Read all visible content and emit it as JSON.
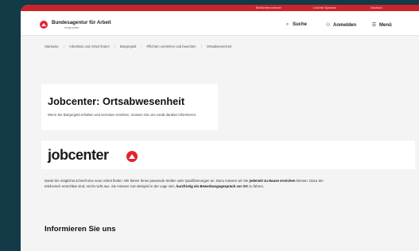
{
  "topbar": {
    "links": [
      "Behördennummer",
      "Leichte Sprache",
      "Deutsch"
    ]
  },
  "header": {
    "brand": "Bundesagentur für Arbeit",
    "brand_sub": "bringt weiter",
    "search_label": "Suche",
    "login_label": "Anmelden",
    "menu_label": "Menü",
    "search_icon": "⌕",
    "user_icon": "⚇",
    "menu_icon": "☰"
  },
  "breadcrumb": [
    "Startseite",
    "Arbeitslos und Arbeit finden",
    "Bürgergeld",
    "Pflichten verstehen und beachten",
    "Ortsabwesenheit"
  ],
  "main": {
    "title": "Jobcenter: Ortsabwesenheit",
    "intro": "Wenn Sie Bürgergeld erhalten und verreisen möchten, müssen Sie uns vorab darüber informieren.",
    "logo_text": "jobcenter",
    "body": {
      "p1": "Damit Sie möglichst schnell eine neue Arbeit finden: Wir bieten Ihnen passende Stellen oder Qualifizierungen an. Dazu müssen wir Sie ",
      "b1": "jederzeit zu Hause erreichen",
      "p2": " können. Dazu Sie telefonisch erreichbar sind, reicht nicht aus. Sie müssen zum Beispiel in der Lage sein, ",
      "b2": "kurzfristig ein Bewerbungsgespräch vor Ort",
      "p3": " zu führen."
    },
    "section_heading": "Informieren Sie uns"
  },
  "colors": {
    "brand_red": "#e3232f",
    "topbar_red": "#c9242b",
    "device": "#123a47"
  }
}
